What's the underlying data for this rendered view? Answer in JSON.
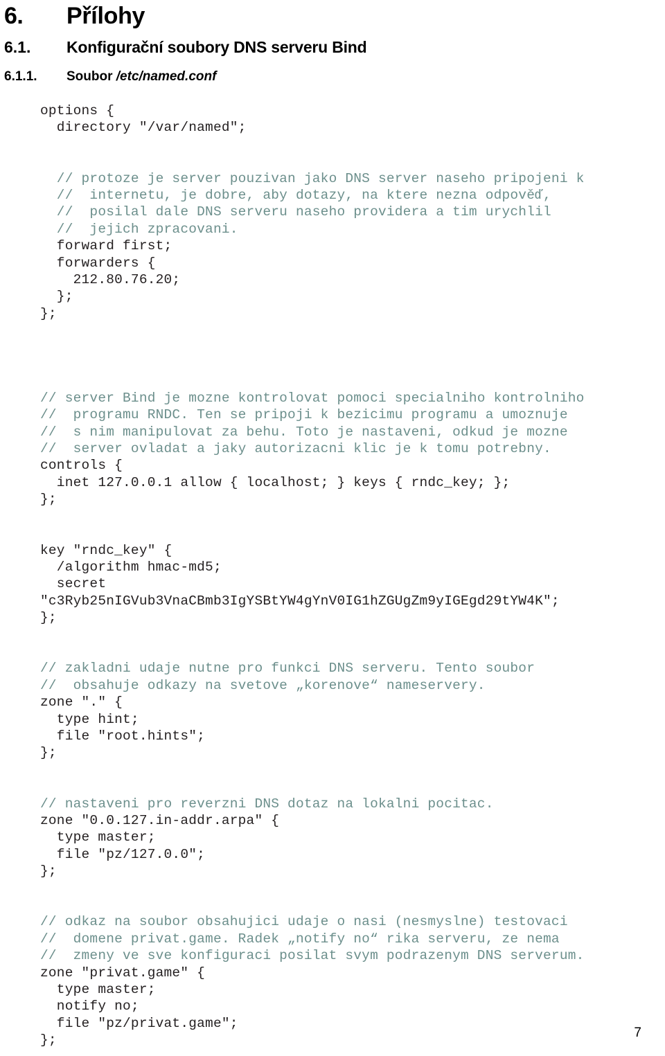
{
  "document": {
    "language": "cs",
    "page_number": "7"
  },
  "headings": {
    "h1": {
      "number": "6.",
      "text": "Přílohy"
    },
    "h2": {
      "number": "6.1.",
      "text": "Konfigurační soubory DNS serveru Bind"
    },
    "h3": {
      "number": "6.1.1.",
      "text_prefix": "Soubor ",
      "text_italic": "/etc/named.conf"
    }
  },
  "colors": {
    "text": "#231f20",
    "comment": "#6c8f8c",
    "heading": "#000000",
    "background": "#ffffff"
  },
  "code": {
    "language": "named.conf",
    "lines": [
      {
        "kind": "code",
        "text": "options {"
      },
      {
        "kind": "code",
        "text": "  directory \"/var/named\";"
      },
      {
        "kind": "blank",
        "text": ""
      },
      {
        "kind": "comment",
        "text": "  // protoze je server pouzivan jako DNS server naseho pripojeni k"
      },
      {
        "kind": "comment",
        "text": "  //  internetu, je dobre, aby dotazy, na ktere nezna odpověď,"
      },
      {
        "kind": "comment",
        "text": "  //  posilal dale DNS serveru naseho providera a tim urychlil"
      },
      {
        "kind": "comment",
        "text": "  //  jejich zpracovani."
      },
      {
        "kind": "code",
        "text": "  forward first;"
      },
      {
        "kind": "code",
        "text": "  forwarders {"
      },
      {
        "kind": "code",
        "text": "    212.80.76.20;"
      },
      {
        "kind": "code",
        "text": "  };"
      },
      {
        "kind": "code",
        "text": "};"
      },
      {
        "kind": "blank",
        "text": ""
      },
      {
        "kind": "blank",
        "text": ""
      },
      {
        "kind": "comment",
        "text": "// server Bind je mozne kontrolovat pomoci specialniho kontrolniho"
      },
      {
        "kind": "comment",
        "text": "//  programu RNDC. Ten se pripoji k bezicimu programu a umoznuje"
      },
      {
        "kind": "comment",
        "text": "//  s nim manipulovat za behu. Toto je nastaveni, odkud je mozne"
      },
      {
        "kind": "comment",
        "text": "//  server ovladat a jaky autorizacni klic je k tomu potrebny."
      },
      {
        "kind": "code",
        "text": "controls {"
      },
      {
        "kind": "code",
        "text": "  inet 127.0.0.1 allow { localhost; } keys { rndc_key; };"
      },
      {
        "kind": "code",
        "text": "};"
      },
      {
        "kind": "blank",
        "text": ""
      },
      {
        "kind": "code",
        "text": "key \"rndc_key\" {"
      },
      {
        "kind": "code",
        "text": "  /algorithm hmac-md5;"
      },
      {
        "kind": "code",
        "text": "  secret"
      },
      {
        "kind": "code",
        "text": "\"c3Ryb25nIGVub3VnaCBmb3IgYSBtYW4gYnV0IG1hZGUgZm9yIGEgd29tYW4K\";"
      },
      {
        "kind": "code",
        "text": "};"
      },
      {
        "kind": "blank",
        "text": ""
      },
      {
        "kind": "comment",
        "text": "// zakladni udaje nutne pro funkci DNS serveru. Tento soubor"
      },
      {
        "kind": "comment",
        "text": "//  obsahuje odkazy na svetove „korenove“ nameservery."
      },
      {
        "kind": "code",
        "text": "zone \".\" {"
      },
      {
        "kind": "code",
        "text": "  type hint;"
      },
      {
        "kind": "code",
        "text": "  file \"root.hints\";"
      },
      {
        "kind": "code",
        "text": "};"
      },
      {
        "kind": "blank",
        "text": ""
      },
      {
        "kind": "comment",
        "text": "// nastaveni pro reverzni DNS dotaz na lokalni pocitac."
      },
      {
        "kind": "code",
        "text": "zone \"0.0.127.in-addr.arpa\" {"
      },
      {
        "kind": "code",
        "text": "  type master;"
      },
      {
        "kind": "code",
        "text": "  file \"pz/127.0.0\";"
      },
      {
        "kind": "code",
        "text": "};"
      },
      {
        "kind": "blank",
        "text": ""
      },
      {
        "kind": "comment",
        "text": "// odkaz na soubor obsahujici udaje o nasi (nesmyslne) testovaci"
      },
      {
        "kind": "comment",
        "text": "//  domene privat.game. Radek „notify no“ rika serveru, ze nema"
      },
      {
        "kind": "comment",
        "text": "//  zmeny ve sve konfiguraci posilat svym podrazenym DNS serverum."
      },
      {
        "kind": "code",
        "text": "zone \"privat.game\" {"
      },
      {
        "kind": "code",
        "text": "  type master;"
      },
      {
        "kind": "code",
        "text": "  notify no;"
      },
      {
        "kind": "code",
        "text": "  file \"pz/privat.game\";"
      },
      {
        "kind": "code",
        "text": "};"
      }
    ]
  }
}
